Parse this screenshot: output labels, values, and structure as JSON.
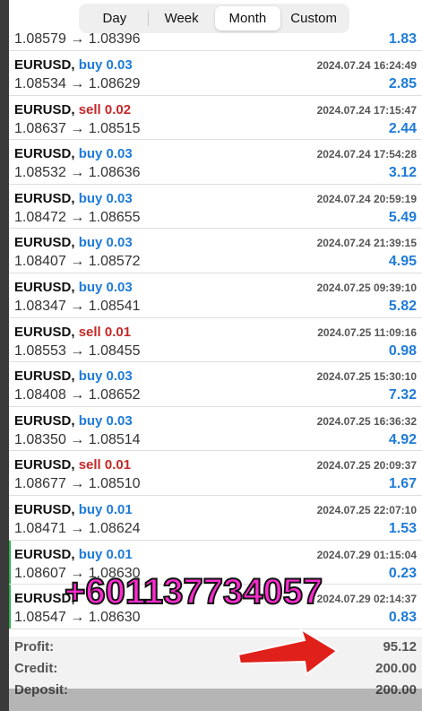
{
  "tabs": [
    {
      "label": "Day",
      "active": false
    },
    {
      "label": "Week",
      "active": false
    },
    {
      "label": "Month",
      "active": true
    },
    {
      "label": "Custom",
      "active": false
    }
  ],
  "trades": [
    {
      "symbol": "",
      "side_text": "",
      "side": "",
      "time": "",
      "prices": "1.08579 → 1.08396",
      "profit": "1.83",
      "marked": false
    },
    {
      "symbol": "EURUSD,",
      "side_text": "buy 0.03",
      "side": "buy",
      "time": "2024.07.24 16:24:49",
      "prices": "1.08534 → 1.08629",
      "profit": "2.85",
      "marked": false
    },
    {
      "symbol": "EURUSD,",
      "side_text": "sell 0.02",
      "side": "sell",
      "time": "2024.07.24 17:15:47",
      "prices": "1.08637 → 1.08515",
      "profit": "2.44",
      "marked": false
    },
    {
      "symbol": "EURUSD,",
      "side_text": "buy 0.03",
      "side": "buy",
      "time": "2024.07.24 17:54:28",
      "prices": "1.08532 → 1.08636",
      "profit": "3.12",
      "marked": false
    },
    {
      "symbol": "EURUSD,",
      "side_text": "buy 0.03",
      "side": "buy",
      "time": "2024.07.24 20:59:19",
      "prices": "1.08472 → 1.08655",
      "profit": "5.49",
      "marked": false
    },
    {
      "symbol": "EURUSD,",
      "side_text": "buy 0.03",
      "side": "buy",
      "time": "2024.07.24 21:39:15",
      "prices": "1.08407 → 1.08572",
      "profit": "4.95",
      "marked": false
    },
    {
      "symbol": "EURUSD,",
      "side_text": "buy 0.03",
      "side": "buy",
      "time": "2024.07.25 09:39:10",
      "prices": "1.08347 → 1.08541",
      "profit": "5.82",
      "marked": false
    },
    {
      "symbol": "EURUSD,",
      "side_text": "sell 0.01",
      "side": "sell",
      "time": "2024.07.25 11:09:16",
      "prices": "1.08553 → 1.08455",
      "profit": "0.98",
      "marked": false
    },
    {
      "symbol": "EURUSD,",
      "side_text": "buy 0.03",
      "side": "buy",
      "time": "2024.07.25 15:30:10",
      "prices": "1.08408 → 1.08652",
      "profit": "7.32",
      "marked": false
    },
    {
      "symbol": "EURUSD,",
      "side_text": "buy 0.03",
      "side": "buy",
      "time": "2024.07.25 16:36:32",
      "prices": "1.08350 → 1.08514",
      "profit": "4.92",
      "marked": false
    },
    {
      "symbol": "EURUSD,",
      "side_text": "sell 0.01",
      "side": "sell",
      "time": "2024.07.25 20:09:37",
      "prices": "1.08677 → 1.08510",
      "profit": "1.67",
      "marked": false
    },
    {
      "symbol": "EURUSD,",
      "side_text": "buy 0.01",
      "side": "buy",
      "time": "2024.07.25 22:07:10",
      "prices": "1.08471 → 1.08624",
      "profit": "1.53",
      "marked": false
    },
    {
      "symbol": "EURUSD,",
      "side_text": "buy 0.01",
      "side": "buy",
      "time": "2024.07.29 01:15:04",
      "prices": "1.08607 → 1.08630",
      "profit": "0.23",
      "marked": true
    },
    {
      "symbol": "EURUSD,",
      "side_text": "",
      "side": "buy",
      "time": "2024.07.29 02:14:37",
      "prices": "1.08547 → 1.08630",
      "profit": "0.83",
      "marked": true
    }
  ],
  "summary": {
    "profit_label": "Profit:",
    "profit_value": "95.12",
    "credit_label": "Credit:",
    "credit_value": "200.00",
    "deposit_label": "Deposit:",
    "deposit_value": "200.00"
  },
  "overlay_text": "+601137734057",
  "colors": {
    "buy": "#1e7bd8",
    "sell": "#c62828",
    "marker": "#2db34a",
    "overlay": "#ff2bd0",
    "arrow": "#e0201a"
  }
}
